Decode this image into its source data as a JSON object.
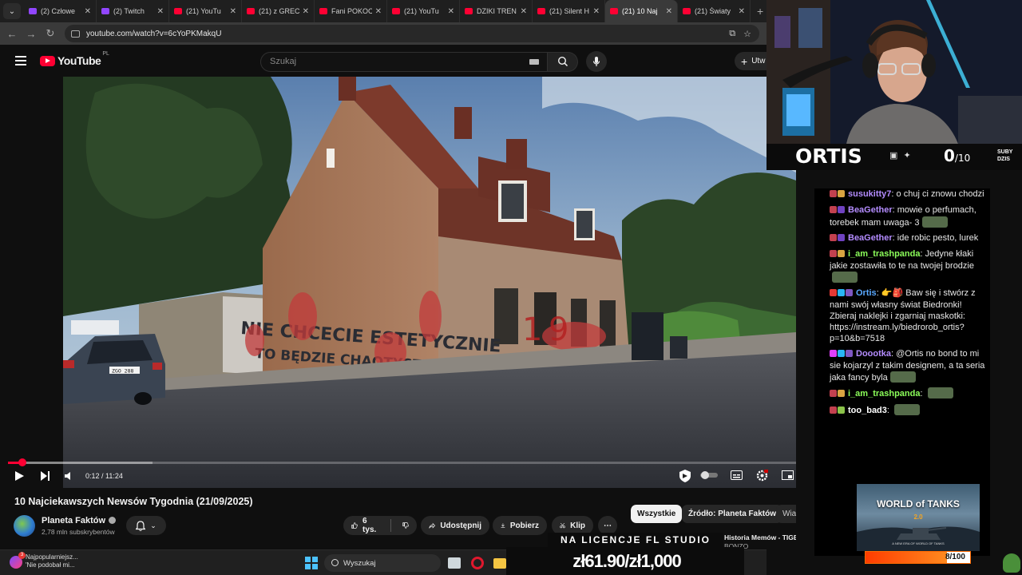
{
  "browser": {
    "tabs": [
      {
        "title": "(2) Człowe",
        "icon": "twitch-icon",
        "active": false
      },
      {
        "title": "(2) Twitch",
        "icon": "twitch-icon",
        "active": false
      },
      {
        "title": "(21) YouTu",
        "icon": "youtube-icon",
        "active": false
      },
      {
        "title": "(21) z GREC",
        "icon": "youtube-icon",
        "active": false
      },
      {
        "title": "Fani POKOC",
        "icon": "youtube-icon",
        "active": false
      },
      {
        "title": "(21) YouTu",
        "icon": "youtube-icon",
        "active": false
      },
      {
        "title": "DZIKI TREN",
        "icon": "youtube-icon",
        "active": false
      },
      {
        "title": "(21) Silent H",
        "icon": "youtube-icon",
        "active": false
      },
      {
        "title": "(21) 10 Naj",
        "icon": "youtube-icon",
        "active": true
      },
      {
        "title": "(21) Światy",
        "icon": "youtube-icon",
        "active": false
      }
    ],
    "url": "youtube.com/watch?v=6cYoPKMakqU"
  },
  "youtube": {
    "logo_text": "YouTube",
    "region": "PL",
    "search_placeholder": "Szukaj",
    "create_label": "Utw"
  },
  "video": {
    "current_time": "0:12",
    "duration": "11:24",
    "time_display": "0:12 / 11:24",
    "progress_fraction": 0.0175,
    "buffered_fraction": 0.18,
    "title": "10 Najciekawszych Newsów Tygodnia (21/09/2025)",
    "channel": "Planeta Faktów",
    "subscribers": "2,78 mln subskrybentów",
    "likes": "6 tys.",
    "share_label": "Udostępnij",
    "download_label": "Pobierz",
    "clip_label": "Klip",
    "graffiti_line1": "NIE CHCECIE ESTETYCZNIE",
    "graffiti_line2": "TO BĘDZIE CHAOTYCZNIE",
    "plate": "ZGO 288"
  },
  "chips": {
    "all": "Wszystkie",
    "source": "Źródło: Planeta Faktów",
    "more": "Wiadomo"
  },
  "sidebar_item": {
    "title": "Historia Memów - TIGER",
    "subtitle": "BONZO"
  },
  "taskbar": {
    "notif_title": "Najpopularniejsz...",
    "notif_text": "'Nie podobał mi...",
    "notif_badge": "3",
    "search": "Wyszukaj"
  },
  "overlay": {
    "streamer": "ORTIS",
    "sub_count": "0",
    "sub_goal": "/10",
    "sub_label_1": "SUBY",
    "sub_label_2": "DZIS",
    "promo_top": "NA LICENCJE FL STUDIO",
    "promo_price": "zł61.90/zł1,000",
    "goal_text": "8/100",
    "goal_fraction": 0.08,
    "ad_title": "WORLD of TANKS",
    "ad_version": "2.0",
    "ad_tagline": "A NEW ERA OF WORLD OF TANKS"
  },
  "chat": [
    {
      "user": "susukitty7",
      "color": "#b48cff",
      "text": "o chuj ci znowu chodzi",
      "badges": [
        "#c3414f",
        "#d9a441"
      ]
    },
    {
      "user": "BeaGether",
      "color": "#b48cff",
      "text": "mowie o perfumach, torebek mam uwaga- 3",
      "badges": [
        "#c3414f",
        "#6f42c1"
      ],
      "emote": true
    },
    {
      "user": "BeaGether",
      "color": "#b48cff",
      "text": "ide robic pesto, lurek",
      "badges": [
        "#c3414f",
        "#6f42c1"
      ]
    },
    {
      "user": "i_am_trashpanda",
      "color": "#8cff5a",
      "text": "Jedyne kłaki jakie zostawiła to te na twojej brodzie",
      "badges": [
        "#c3414f",
        "#d9a441"
      ],
      "emote": true
    },
    {
      "user": "Ortis",
      "color": "#5aa9ff",
      "text": "👉🎒 Baw się i stwórz z nami swój własny świat Biedronki! Zbieraj naklejki i zgarniaj maskotki: https://instream.ly/biedrorob_ortis?p=10&b=7518",
      "badges": [
        "#e53935",
        "#29b6f6",
        "#7e57c2"
      ]
    },
    {
      "user": "Doootka",
      "color": "#b48cff",
      "text": "@Ortis no bond to mi sie kojarzyl z takim designem, a ta seria jaka fancy byla",
      "badges": [
        "#e040fb",
        "#29b6f6",
        "#7e57c2"
      ],
      "emote": true
    },
    {
      "user": "i_am_trashpanda",
      "color": "#8cff5a",
      "text": "",
      "badges": [
        "#c3414f",
        "#d9a441"
      ],
      "emote": true
    },
    {
      "user": "too_bad3",
      "color": "#ffffff",
      "text": "",
      "badges": [
        "#c3414f",
        "#8bc34a"
      ],
      "emote": true
    }
  ]
}
